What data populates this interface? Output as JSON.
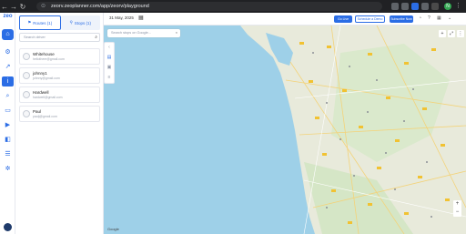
{
  "browser": {
    "url": "zeorv.zeoplanner.com/app/zeorv/playground",
    "profile_initial": "N"
  },
  "rail": {
    "logo": "zeo"
  },
  "panel": {
    "tabs": [
      {
        "label": "Routes (1)",
        "active": true
      },
      {
        "label": "Stops (1)",
        "active": false
      }
    ],
    "search_placeholder": "Search driver",
    "drivers": [
      {
        "name": "Whitehouse",
        "email": "hellothere@gmail.com"
      },
      {
        "name": "johnny1",
        "email": "johnny@gmail.com"
      },
      {
        "name": "Hardwell",
        "email": "hardwell@gmail.com"
      },
      {
        "name": "Paul",
        "email": "paulj@gmail.com"
      }
    ]
  },
  "topbar": {
    "date": "31 May, 2025",
    "btn_optimize": "Go Live",
    "btn_schedule": "Schedule a Demo",
    "btn_subscribe": "Subscribe Now"
  },
  "map": {
    "search_placeholder": "Search stops on Google...",
    "attribution": "Google",
    "sea_color": "#9ed0e8",
    "land_color": "#e8eadb"
  }
}
